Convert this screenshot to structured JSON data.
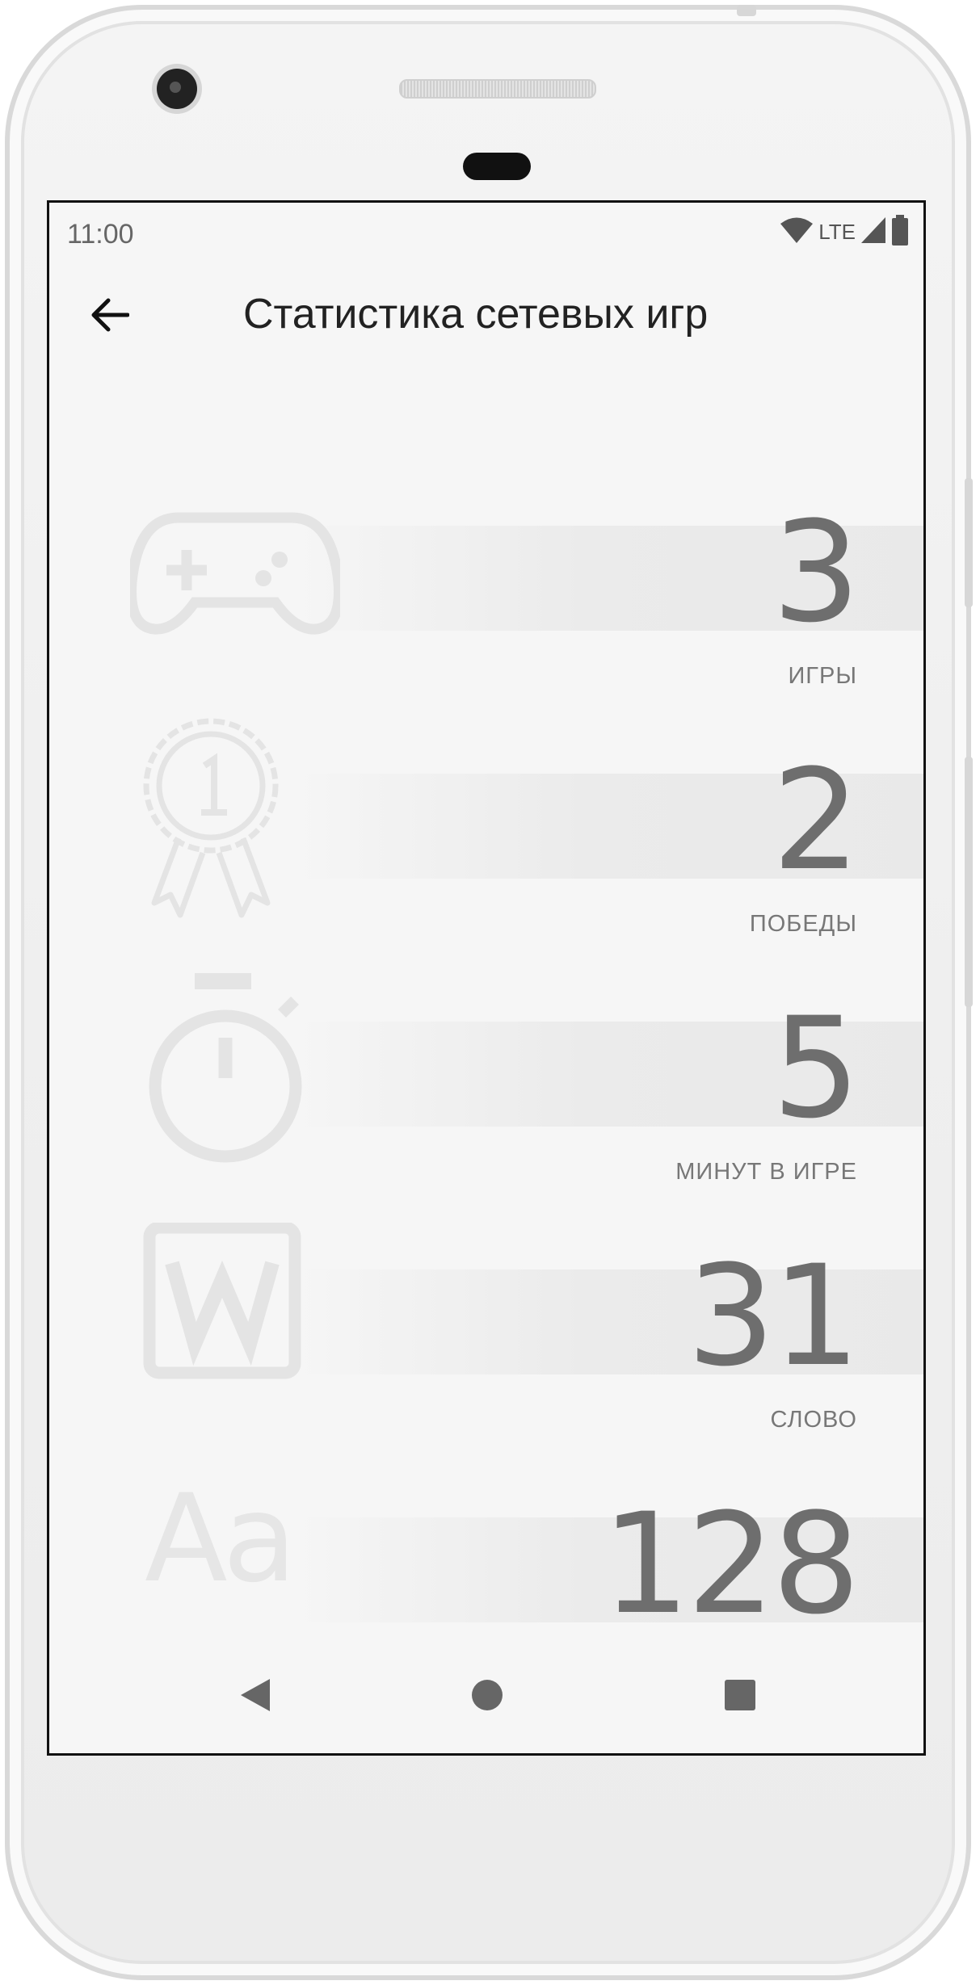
{
  "status_bar": {
    "time": "11:00",
    "network": "LTE",
    "icons": [
      "wifi-icon",
      "signal-icon",
      "battery-icon"
    ]
  },
  "app_bar": {
    "title": "Статистика сетевых игр",
    "back_icon": "arrow-back-icon"
  },
  "stats": [
    {
      "value": "3",
      "label": "ИГРЫ",
      "icon": "gamepad-icon"
    },
    {
      "value": "2",
      "label": "ПОБЕДЫ",
      "icon": "award-medal-icon"
    },
    {
      "value": "5",
      "label": "МИНУТ В ИГРЕ",
      "icon": "stopwatch-icon"
    },
    {
      "value": "31",
      "label": "СЛОВО",
      "icon": "word-w-icon"
    },
    {
      "value": "128",
      "label": "",
      "icon": "letters-aa-icon",
      "icon_text": "Aa"
    }
  ],
  "nav_bar": {
    "items": [
      "back-triangle-icon",
      "home-circle-icon",
      "recents-square-icon"
    ]
  },
  "colors": {
    "screen_bg": "#f6f6f6",
    "value_text": "#6e6e6e",
    "icon_faded": "#e6e6e6",
    "title_text": "#222222"
  }
}
